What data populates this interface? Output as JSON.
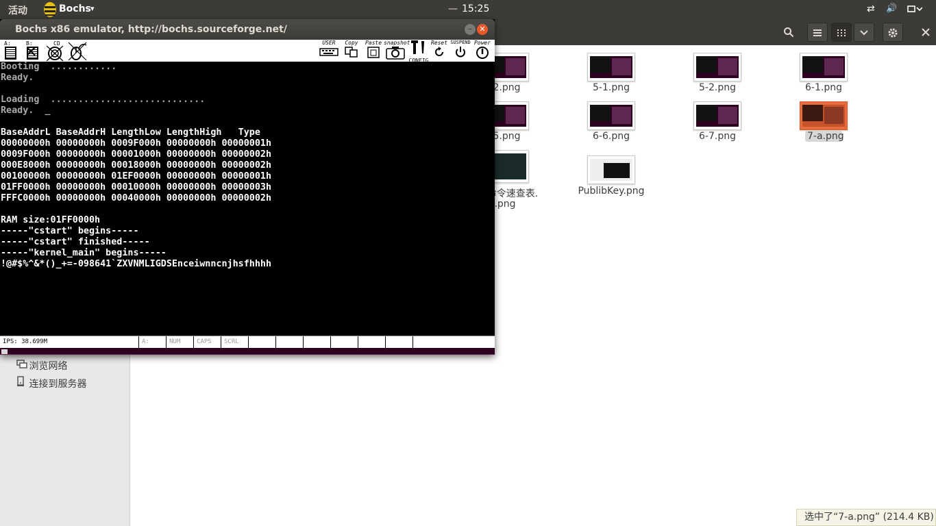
{
  "topbar": {
    "activities": "活动",
    "app_name": "Bochs",
    "app_caret": "▾",
    "dash": "—",
    "clock": "15:25",
    "indicators": {
      "network": "⇄",
      "volume": "🔊",
      "menu": "▾"
    },
    "colors": {
      "bar": "#3c3b37",
      "accent": "#e95a2b"
    }
  },
  "file_manager": {
    "header_buttons": [
      "search-icon",
      "list-view-icon",
      "grid-view-icon",
      "chevron-down-icon",
      "gear-icon",
      "close-icon"
    ],
    "sidebar": [
      {
        "icon": "network-icon",
        "label": "浏览网络"
      },
      {
        "icon": "server-icon",
        "label": "连接到服务器"
      }
    ],
    "files": [
      {
        "name": "-2.png"
      },
      {
        "name": "5-1.png"
      },
      {
        "name": "5-2.png"
      },
      {
        "name": "6-1.png"
      },
      {
        "name": "-5.png"
      },
      {
        "name": "6-6.png"
      },
      {
        "name": "6-7.png"
      },
      {
        "name": "7-a.png",
        "selected": true
      },
      {
        "name_line1": "命令速查表.",
        "name_line2": ".png"
      },
      {
        "name": "PublibKey.png"
      }
    ],
    "status": "选中了“7-a.png” (214.4 KB)"
  },
  "bochs": {
    "title": "Bochs x86 emulator, http://bochs.sourceforge.net/",
    "toolbar": {
      "floppy_a": "A:",
      "floppy_b": "B:",
      "cdrom": "CD",
      "user": "USER",
      "copy": "Copy",
      "paste": "Paste",
      "snapshot": "snapshot",
      "config": "CONFIG",
      "reset": "Reset",
      "suspend": "SUSPEND",
      "power": "Power"
    },
    "screen": [
      "Booting  ............",
      "Ready.",
      "",
      "Loading  ............................",
      "Ready.  _",
      "",
      "BaseAddrL BaseAddrH LengthLow LengthHigh   Type",
      "00000000h 00000000h 0009F000h 00000000h 00000001h",
      "0009F000h 00000000h 00001000h 00000000h 00000002h",
      "000E8000h 00000000h 00018000h 00000000h 00000002h",
      "00100000h 00000000h 01EF0000h 00000000h 00000001h",
      "01FF0000h 00000000h 00010000h 00000000h 00000003h",
      "FFFC0000h 00000000h 00040000h 00000000h 00000002h",
      "",
      "RAM size:01FF0000h",
      "-----\"cstart\" begins-----",
      "-----\"cstart\" finished-----",
      "-----\"kernel_main\" begins-----",
      "!@#$%^&*()_+=-098641`ZXVNMLIGDSEnceiwnncnjhsfhhhh"
    ],
    "status": {
      "ips": "IPS: 38.699M",
      "drive": "A:",
      "num": "NUM",
      "caps": "CAPS",
      "scrl": "SCRL"
    }
  }
}
